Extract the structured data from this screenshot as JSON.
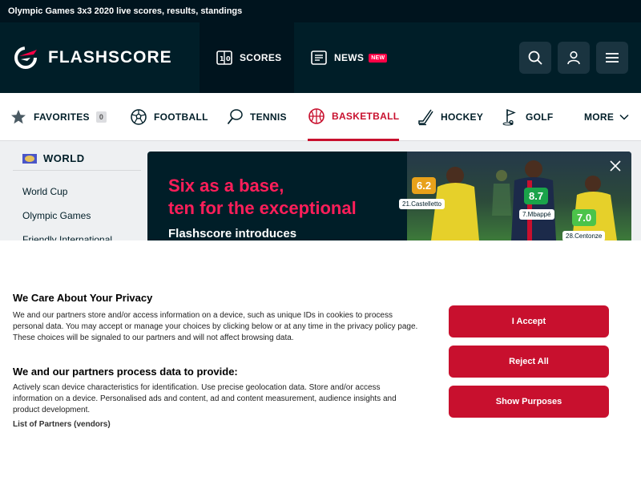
{
  "page_title": "Olympic Games 3x3 2020 live scores, results, standings",
  "header": {
    "logo_text": "FLASHSCORE",
    "nav": [
      {
        "label": "SCORES",
        "icon": "scores-icon"
      },
      {
        "label": "NEWS",
        "icon": "news-icon",
        "badge": "NEW"
      }
    ],
    "buttons": [
      "search-icon",
      "user-icon",
      "menu-icon"
    ]
  },
  "sports": {
    "favorites": {
      "label": "FAVORITES",
      "count": "0"
    },
    "items": [
      "FOOTBALL",
      "TENNIS",
      "BASKETBALL",
      "HOCKEY",
      "GOLF"
    ],
    "active": "BASKETBALL",
    "more": "MORE"
  },
  "sidebar": {
    "region": "WORLD",
    "links": [
      "World Cup",
      "Olympic Games",
      "Friendly International"
    ]
  },
  "banner": {
    "line1": "Six as a base,",
    "line2": "ten for the exceptional",
    "line3": "Flashscore introduces",
    "ratings": [
      {
        "value": "6.2",
        "player": "21.Castelletto",
        "color": "#e8a11a"
      },
      {
        "value": "8.7",
        "player": "7.Mbappé",
        "color": "#1aa34a"
      },
      {
        "value": "7.0",
        "player": "28.Centonze",
        "color": "#4cc34a"
      }
    ]
  },
  "consent": {
    "title": "We Care About Your Privacy",
    "text": "We and our partners store and/or access information on a device, such as unique IDs in cookies to process personal data. You may accept or manage your choices by clicking below or at any time in the privacy policy page. These choices will be signaled to our partners and will not affect browsing data.",
    "subtitle": "We and our partners process data to provide:",
    "purposes": "Actively scan device characteristics for identification. Use precise geolocation data. Store and/or access information on a device. Personalised ads and content, ad and content measurement, audience insights and product development.",
    "partners_link": "List of Partners (vendors)",
    "accept": "I Accept",
    "reject": "Reject All",
    "purposes_button": "Show Purposes"
  },
  "colors": {
    "brand_dark": "#001e28",
    "accent": "#c8102e",
    "highlight": "#ff1e5a"
  }
}
